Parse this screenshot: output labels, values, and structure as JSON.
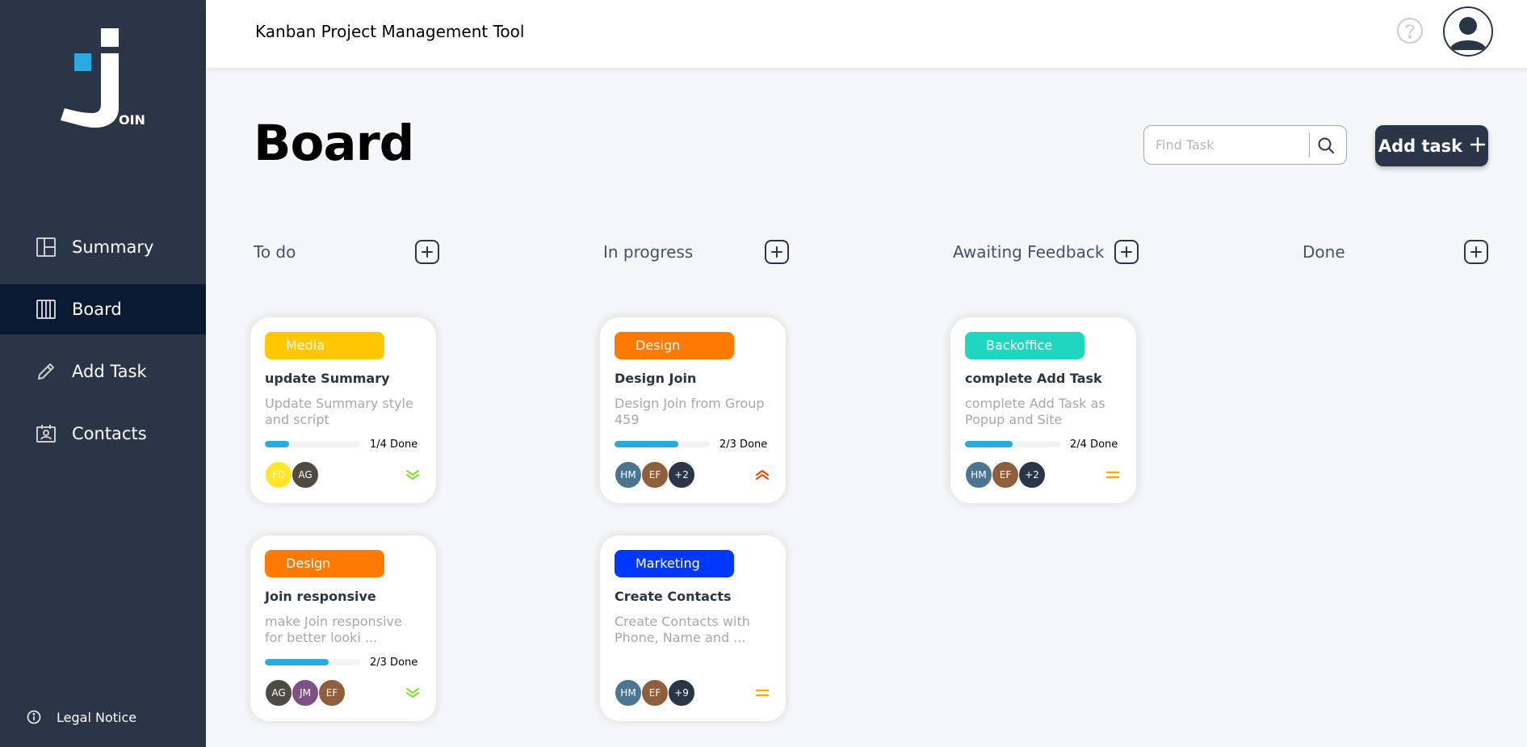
{
  "app": {
    "title": "Kanban Project Management Tool",
    "logo_text": "OIN"
  },
  "sidebar": {
    "items": [
      {
        "label": "Summary",
        "icon": "summary-icon"
      },
      {
        "label": "Board",
        "icon": "board-icon",
        "active": true
      },
      {
        "label": "Add Task",
        "icon": "pencil-icon"
      },
      {
        "label": "Contacts",
        "icon": "contacts-icon"
      }
    ],
    "legal": "Legal Notice"
  },
  "board": {
    "title": "Board",
    "search_placeholder": "Find Task",
    "add_task_label": "Add task"
  },
  "columns": [
    {
      "title": "To do"
    },
    {
      "title": "In progress"
    },
    {
      "title": "Awaiting Feedback"
    },
    {
      "title": "Done"
    }
  ],
  "colors": {
    "Media": "#ffc701",
    "Design": "#ff7a00",
    "Backoffice": "#1fd7c1",
    "Marketing": "#0038ff",
    "progress": "#29abe2",
    "sidebar": "#2a3647"
  },
  "cards": [
    {
      "column": "To do",
      "category": "Media",
      "title": "update Summary",
      "description": "Update Summary style and script",
      "progress": {
        "done": 1,
        "total": 4,
        "text": "1/4 Done"
      },
      "avatars": [
        {
          "initials": "FD",
          "color": "#ffe62b"
        },
        {
          "initials": "AG",
          "color": "#4f4b43"
        }
      ],
      "priority": "low"
    },
    {
      "column": "To do",
      "category": "Design",
      "title": "Join responsive",
      "description": "make Join responsive for better looki ...",
      "progress": {
        "done": 2,
        "total": 3,
        "text": "2/3 Done"
      },
      "avatars": [
        {
          "initials": "AG",
          "color": "#4f4b43"
        },
        {
          "initials": "JM",
          "color": "#7e5186"
        },
        {
          "initials": "EF",
          "color": "#8e5f3c"
        }
      ],
      "priority": "low"
    },
    {
      "column": "In progress",
      "category": "Design",
      "title": "Design Join",
      "description": "Design Join from Group 459",
      "progress": {
        "done": 2,
        "total": 3,
        "text": "2/3 Done"
      },
      "avatars": [
        {
          "initials": "HM",
          "color": "#4d7592"
        },
        {
          "initials": "EF",
          "color": "#8e5f3c"
        },
        {
          "initials": "+2",
          "color": "#2a3647"
        }
      ],
      "priority": "urgent"
    },
    {
      "column": "In progress",
      "category": "Marketing",
      "title": "Create Contacts",
      "description": "Create Contacts with Phone, Name and ...",
      "avatars": [
        {
          "initials": "HM",
          "color": "#4d7592"
        },
        {
          "initials": "EF",
          "color": "#8e5f3c"
        },
        {
          "initials": "+9",
          "color": "#2a3647"
        }
      ],
      "priority": "medium"
    },
    {
      "column": "Awaiting Feedback",
      "category": "Backoffice",
      "title": "complete Add Task",
      "description": "complete Add Task as Popup and Site",
      "progress": {
        "done": 2,
        "total": 4,
        "text": "2/4 Done"
      },
      "avatars": [
        {
          "initials": "HM",
          "color": "#4d7592"
        },
        {
          "initials": "EF",
          "color": "#8e5f3c"
        },
        {
          "initials": "+2",
          "color": "#2a3647"
        }
      ],
      "priority": "medium"
    }
  ]
}
